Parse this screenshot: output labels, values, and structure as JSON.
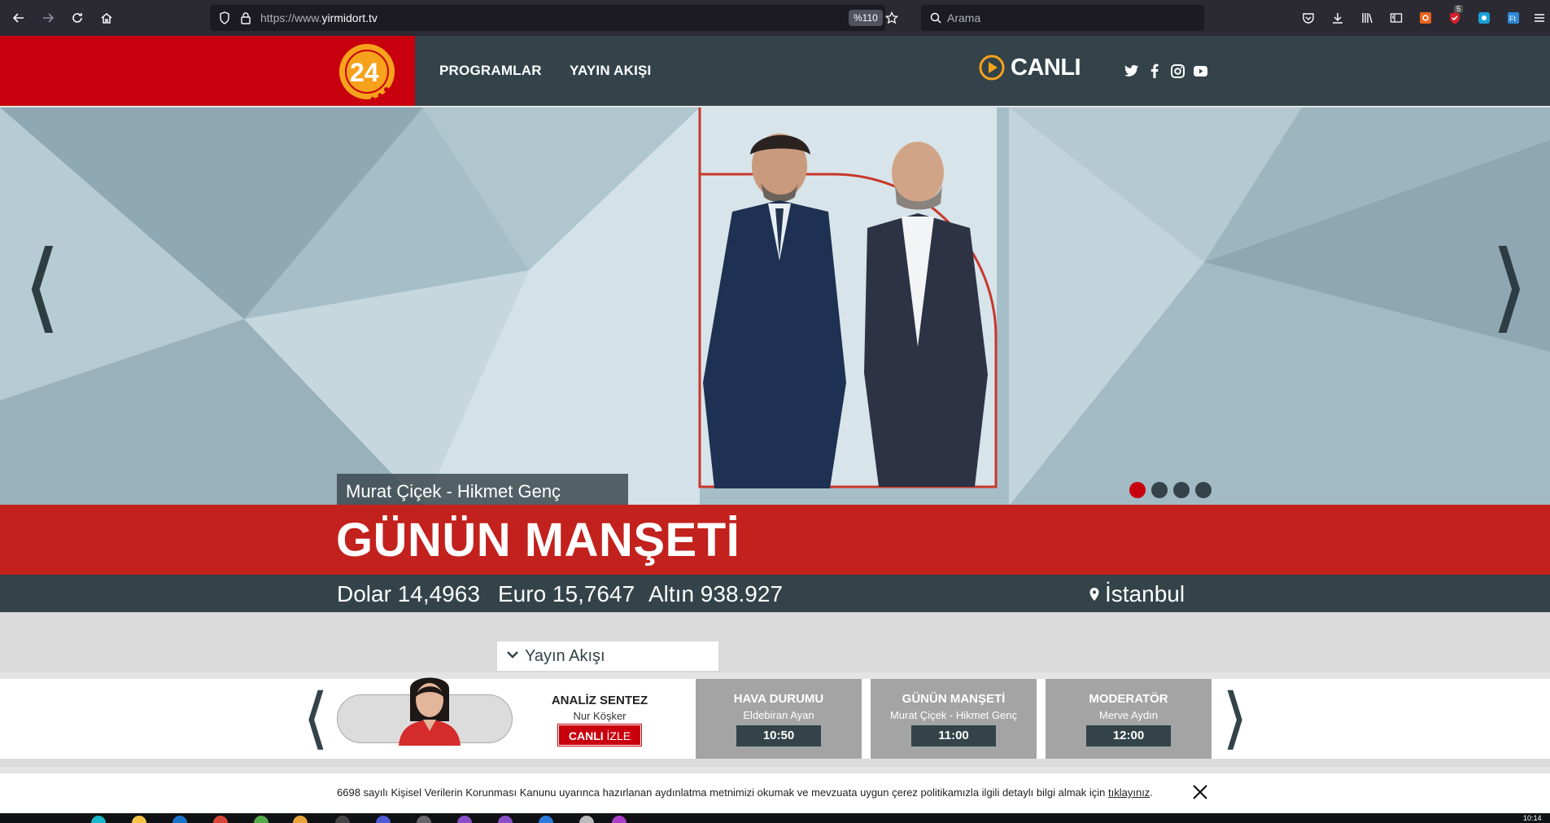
{
  "browser": {
    "url_prefix": "https://www.",
    "url_domain": "yirmidort.tv",
    "zoom": "%110",
    "search_placeholder": "Arama",
    "badge_count": "5"
  },
  "header": {
    "logo_text": "24",
    "menu": [
      {
        "label": "PROGRAMLAR"
      },
      {
        "label": "YAYIN AKIŞI"
      }
    ],
    "live_label": "CANLI"
  },
  "hero": {
    "presenters": "Murat Çiçek - Hikmet Genç",
    "slide_count": 4,
    "active_slide": 1
  },
  "show_title": "GÜNÜN MANŞETİ",
  "market": {
    "dolar": "Dolar 14,4963",
    "euro": "Euro 15,7647",
    "altin": "Altın 938.927",
    "city": "İstanbul"
  },
  "schedule": {
    "tab_label": "Yayın Akışı",
    "current": {
      "title": "ANALİZ SENTEZ",
      "host": "Nur Köşker",
      "live_bold": "CANLI",
      "live_rest": " İZLE"
    },
    "items": [
      {
        "title": "HAVA DURUMU",
        "host": "Eldebiran Ayan",
        "time": "10:50"
      },
      {
        "title": "GÜNÜN MANŞETİ",
        "host": "Murat Çiçek - Hikmet Genç",
        "time": "11:00"
      },
      {
        "title": "MODERATÖR",
        "host": "Merve Aydın",
        "time": "12:00"
      }
    ]
  },
  "cookie": {
    "text": "6698 sayılı Kişisel Verilerin Korunması Kanunu uyarınca hazırlanan aydınlatma metnimizi okumak ve mevzuata uygun çerez politikamızla ilgili detaylı bilgi almak için ",
    "link": "tıklayınız",
    "end": "."
  },
  "taskbar": {
    "clock": "10:14"
  },
  "colors": {
    "brand_red": "#c8000d",
    "brand_dark": "#334349",
    "accent_orange": "#f7a21b"
  }
}
